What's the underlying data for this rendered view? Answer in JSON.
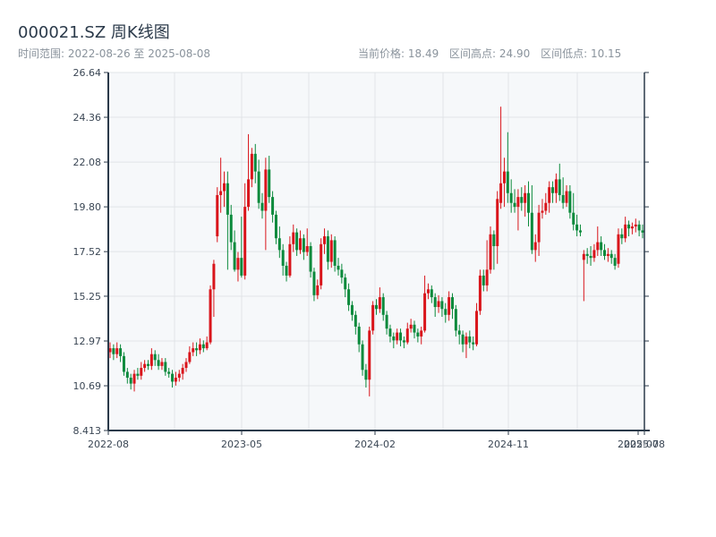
{
  "header": {
    "title": "000021.SZ 周K线图",
    "range_label": "时间范围: 2022-08-26 至 2025-08-08",
    "current_price": "当前价格: 18.49",
    "range_high": "区间高点: 24.90",
    "range_low": "区间低点: 10.15"
  },
  "colors": {
    "up": "#d9151b",
    "down": "#0b8a3c",
    "plot_bg": "#f6f8fa",
    "grid": "#e1e4e8",
    "axis": "#2b3a4a"
  },
  "chart_data": {
    "type": "candlestick",
    "title": "000021.SZ 周K线图",
    "interval": "weekly",
    "ylim": [
      8.413,
      26.64
    ],
    "y_ticks": [
      "8.413",
      "10.69",
      "12.97",
      "15.25",
      "17.52",
      "19.80",
      "22.08",
      "24.36",
      "26.64"
    ],
    "x_ticks": [
      "2022-08",
      "2023-05",
      "2024-02",
      "2024-11",
      "2025-07",
      "2025-08"
    ],
    "grid": true,
    "candle_fields": [
      "open",
      "close",
      "low",
      "high"
    ],
    "candles": [
      [
        12.4,
        12.6,
        12.1,
        12.9
      ],
      [
        12.6,
        12.3,
        12.0,
        12.8
      ],
      [
        12.3,
        12.6,
        12.1,
        12.9
      ],
      [
        12.6,
        12.2,
        11.9,
        12.8
      ],
      [
        12.2,
        11.4,
        11.2,
        12.4
      ],
      [
        11.4,
        11.1,
        10.8,
        11.6
      ],
      [
        11.1,
        10.8,
        10.5,
        11.3
      ],
      [
        10.8,
        11.3,
        10.4,
        11.5
      ],
      [
        11.3,
        11.2,
        11.0,
        11.6
      ],
      [
        11.2,
        11.6,
        11.0,
        11.9
      ],
      [
        11.6,
        11.8,
        11.4,
        12.0
      ],
      [
        11.8,
        11.7,
        11.5,
        12.0
      ],
      [
        11.7,
        12.3,
        11.5,
        12.6
      ],
      [
        12.3,
        12.0,
        11.7,
        12.5
      ],
      [
        12.0,
        11.7,
        11.5,
        12.3
      ],
      [
        11.7,
        11.9,
        11.5,
        12.1
      ],
      [
        11.9,
        11.4,
        11.2,
        12.1
      ],
      [
        11.4,
        11.3,
        11.1,
        11.6
      ],
      [
        11.3,
        10.9,
        10.6,
        11.5
      ],
      [
        10.9,
        11.1,
        10.7,
        11.4
      ],
      [
        11.1,
        11.3,
        10.9,
        11.5
      ],
      [
        11.3,
        11.6,
        11.0,
        11.8
      ],
      [
        11.6,
        11.9,
        11.4,
        12.1
      ],
      [
        11.9,
        12.4,
        11.8,
        12.7
      ],
      [
        12.4,
        12.6,
        12.2,
        12.9
      ],
      [
        12.6,
        12.5,
        12.2,
        12.9
      ],
      [
        12.5,
        12.8,
        12.3,
        13.1
      ],
      [
        12.8,
        12.6,
        12.4,
        13.0
      ],
      [
        12.6,
        12.9,
        12.5,
        13.2
      ],
      [
        12.9,
        15.6,
        12.8,
        15.8
      ],
      [
        15.6,
        16.9,
        14.2,
        17.1
      ],
      [
        18.3,
        20.4,
        18.0,
        20.8
      ],
      [
        20.4,
        20.6,
        19.5,
        22.3
      ],
      [
        20.6,
        21.0,
        19.8,
        21.6
      ],
      [
        21.0,
        19.4,
        16.6,
        21.6
      ],
      [
        19.4,
        18.0,
        17.6,
        19.9
      ],
      [
        18.0,
        16.6,
        16.5,
        18.6
      ],
      [
        16.6,
        17.2,
        16.0,
        17.5
      ],
      [
        17.2,
        16.3,
        16.2,
        19.3
      ],
      [
        16.3,
        19.8,
        16.1,
        21.0
      ],
      [
        19.8,
        21.2,
        19.6,
        23.5
      ],
      [
        21.2,
        22.5,
        20.8,
        22.8
      ],
      [
        22.5,
        21.6,
        21.0,
        23.0
      ],
      [
        21.6,
        20.0,
        19.7,
        22.2
      ],
      [
        20.0,
        19.6,
        19.2,
        20.5
      ],
      [
        19.6,
        21.7,
        17.6,
        22.3
      ],
      [
        21.7,
        20.3,
        20.0,
        22.4
      ],
      [
        20.3,
        19.4,
        19.0,
        20.6
      ],
      [
        19.4,
        18.2,
        17.9,
        19.6
      ],
      [
        18.2,
        17.6,
        17.2,
        18.8
      ],
      [
        17.6,
        16.8,
        16.3,
        17.9
      ],
      [
        16.8,
        16.3,
        16.0,
        17.0
      ],
      [
        16.3,
        17.9,
        16.2,
        18.3
      ],
      [
        17.9,
        18.5,
        17.5,
        18.9
      ],
      [
        18.5,
        17.6,
        17.3,
        18.7
      ],
      [
        17.6,
        18.2,
        17.4,
        18.6
      ],
      [
        18.2,
        17.5,
        17.1,
        18.4
      ],
      [
        17.5,
        17.8,
        17.3,
        18.7
      ],
      [
        17.8,
        16.5,
        16.2,
        18.0
      ],
      [
        16.5,
        15.3,
        15.0,
        16.7
      ],
      [
        15.3,
        15.8,
        15.1,
        16.1
      ],
      [
        15.8,
        17.9,
        15.6,
        18.2
      ],
      [
        17.9,
        18.3,
        17.4,
        18.7
      ],
      [
        18.3,
        17.0,
        16.6,
        18.6
      ],
      [
        17.0,
        18.1,
        16.7,
        18.4
      ],
      [
        18.1,
        16.8,
        16.5,
        18.3
      ],
      [
        16.8,
        16.6,
        16.3,
        17.2
      ],
      [
        16.6,
        16.2,
        15.9,
        16.9
      ],
      [
        16.2,
        15.6,
        15.2,
        16.4
      ],
      [
        15.6,
        14.8,
        14.5,
        15.9
      ],
      [
        14.8,
        14.3,
        14.0,
        15.0
      ],
      [
        14.3,
        13.7,
        13.3,
        14.5
      ],
      [
        13.7,
        12.8,
        12.4,
        13.9
      ],
      [
        12.8,
        11.5,
        11.2,
        13.0
      ],
      [
        11.5,
        11.0,
        10.6,
        11.8
      ],
      [
        11.0,
        13.5,
        10.15,
        13.7
      ],
      [
        13.5,
        14.8,
        13.3,
        15.0
      ],
      [
        14.8,
        14.6,
        14.3,
        15.1
      ],
      [
        14.6,
        15.2,
        14.4,
        15.7
      ],
      [
        15.2,
        14.3,
        14.0,
        15.4
      ],
      [
        14.3,
        13.6,
        13.3,
        14.5
      ],
      [
        13.6,
        13.2,
        12.9,
        13.8
      ],
      [
        13.2,
        13.0,
        12.6,
        13.4
      ],
      [
        13.0,
        13.4,
        12.8,
        13.6
      ],
      [
        13.4,
        13.0,
        12.7,
        13.6
      ],
      [
        13.0,
        12.9,
        12.6,
        13.2
      ],
      [
        12.9,
        13.6,
        12.8,
        13.9
      ],
      [
        13.6,
        13.8,
        13.4,
        14.1
      ],
      [
        13.8,
        13.4,
        13.1,
        14.0
      ],
      [
        13.4,
        13.2,
        12.9,
        13.6
      ],
      [
        13.2,
        13.5,
        12.8,
        13.7
      ],
      [
        13.5,
        15.4,
        13.4,
        16.3
      ],
      [
        15.4,
        15.6,
        15.1,
        15.9
      ],
      [
        15.6,
        15.2,
        14.9,
        15.8
      ],
      [
        15.2,
        14.7,
        14.2,
        15.4
      ],
      [
        14.7,
        15.0,
        14.4,
        15.3
      ],
      [
        15.0,
        14.6,
        14.2,
        15.2
      ],
      [
        14.6,
        14.3,
        13.9,
        14.9
      ],
      [
        14.3,
        15.2,
        14.0,
        15.5
      ],
      [
        15.2,
        14.6,
        14.1,
        15.4
      ],
      [
        14.6,
        13.5,
        13.2,
        14.8
      ],
      [
        13.5,
        13.3,
        12.8,
        13.8
      ],
      [
        13.3,
        12.8,
        12.4,
        13.5
      ],
      [
        12.8,
        13.2,
        12.1,
        13.4
      ],
      [
        13.2,
        12.9,
        12.6,
        13.5
      ],
      [
        12.9,
        12.8,
        12.5,
        13.2
      ],
      [
        12.8,
        14.5,
        12.7,
        14.9
      ],
      [
        14.5,
        16.3,
        14.3,
        16.6
      ],
      [
        16.3,
        15.8,
        15.5,
        16.6
      ],
      [
        15.8,
        16.6,
        15.5,
        18.1
      ],
      [
        16.6,
        18.4,
        16.4,
        18.8
      ],
      [
        18.4,
        17.8,
        16.6,
        18.6
      ],
      [
        17.8,
        20.2,
        16.9,
        20.6
      ],
      [
        20.0,
        21.0,
        19.7,
        24.9
      ],
      [
        21.0,
        21.6,
        19.8,
        22.3
      ],
      [
        21.6,
        20.5,
        20.0,
        23.6
      ],
      [
        20.5,
        20.0,
        19.5,
        21.2
      ],
      [
        20.0,
        19.8,
        19.5,
        20.7
      ],
      [
        19.8,
        20.3,
        18.6,
        20.7
      ],
      [
        20.3,
        20.0,
        19.6,
        20.8
      ],
      [
        20.0,
        20.5,
        19.3,
        20.9
      ],
      [
        20.5,
        19.5,
        18.8,
        21.1
      ],
      [
        19.5,
        17.6,
        17.4,
        20.9
      ],
      [
        17.6,
        18.0,
        17.0,
        18.4
      ],
      [
        18.0,
        19.5,
        17.3,
        19.9
      ],
      [
        19.5,
        19.6,
        19.2,
        20.2
      ],
      [
        19.6,
        20.0,
        19.4,
        20.5
      ],
      [
        20.0,
        20.8,
        19.5,
        21.1
      ],
      [
        20.8,
        20.5,
        20.0,
        21.1
      ],
      [
        20.5,
        21.2,
        20.0,
        21.5
      ],
      [
        21.2,
        20.4,
        20.1,
        22.0
      ],
      [
        20.4,
        20.0,
        19.7,
        21.3
      ],
      [
        20.0,
        20.6,
        19.8,
        20.9
      ],
      [
        20.6,
        19.5,
        19.2,
        20.9
      ],
      [
        19.5,
        18.9,
        18.6,
        20.5
      ],
      [
        18.9,
        18.6,
        18.3,
        19.4
      ],
      [
        18.6,
        18.5,
        18.3,
        18.9
      ],
      [
        17.1,
        17.4,
        15.0,
        17.6
      ],
      [
        17.4,
        17.3,
        16.9,
        17.7
      ],
      [
        17.3,
        17.2,
        16.8,
        17.8
      ],
      [
        17.2,
        17.6,
        17.0,
        17.9
      ],
      [
        17.6,
        18.0,
        17.3,
        18.8
      ],
      [
        18.0,
        17.6,
        17.3,
        18.3
      ],
      [
        17.6,
        17.3,
        17.1,
        17.9
      ],
      [
        17.3,
        17.4,
        17.0,
        17.7
      ],
      [
        17.4,
        17.2,
        16.9,
        17.6
      ],
      [
        17.2,
        16.8,
        16.6,
        17.4
      ],
      [
        16.9,
        18.4,
        16.7,
        18.7
      ],
      [
        18.4,
        18.2,
        17.9,
        18.7
      ],
      [
        18.2,
        18.9,
        18.0,
        19.3
      ],
      [
        18.9,
        18.7,
        18.3,
        19.1
      ],
      [
        18.7,
        18.8,
        18.4,
        19.0
      ],
      [
        18.8,
        18.9,
        18.5,
        19.2
      ],
      [
        18.9,
        18.6,
        18.3,
        19.1
      ],
      [
        18.6,
        18.49,
        18.2,
        18.9
      ]
    ]
  }
}
